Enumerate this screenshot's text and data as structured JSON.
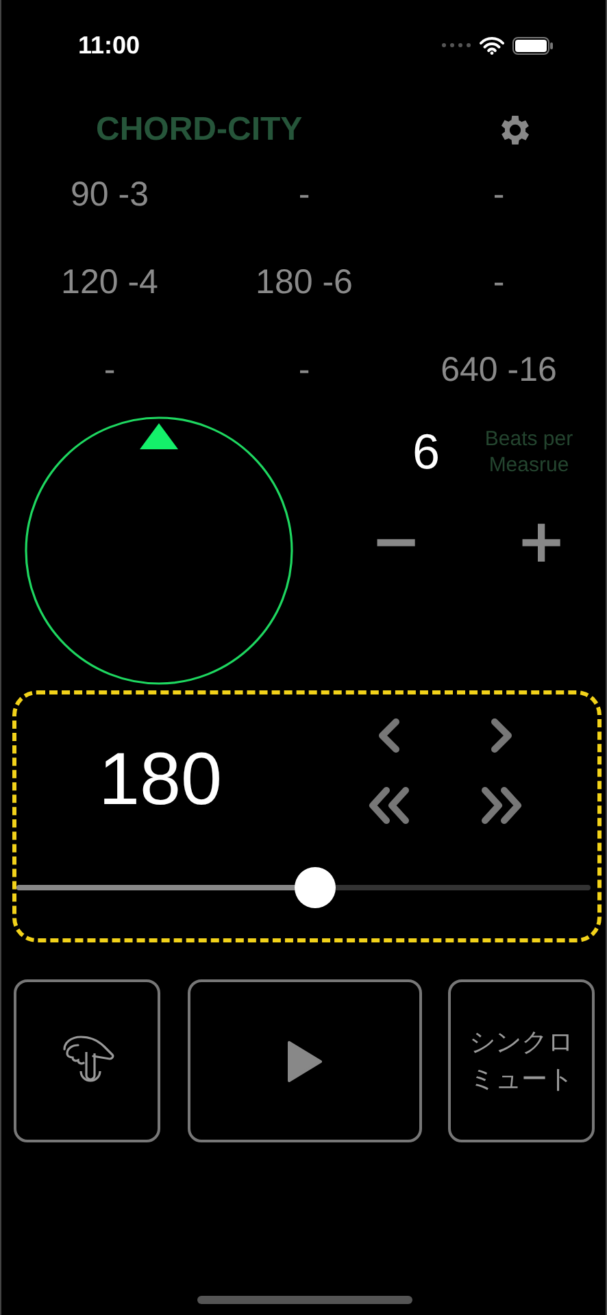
{
  "status_bar": {
    "time": "11:00"
  },
  "header": {
    "title": "CHORD-CITY"
  },
  "presets": [
    [
      "90 -3",
      "-",
      "-"
    ],
    [
      "120 -4",
      "180 -6",
      "-"
    ],
    [
      "-",
      "-",
      "640 -16"
    ]
  ],
  "beats": {
    "value": "6",
    "label": "Beats per Measrue",
    "minus": "−",
    "plus": "+"
  },
  "tempo": {
    "value": "180",
    "level": 0.52
  },
  "controls": {
    "sync_mute": "シンクロミュート"
  }
}
